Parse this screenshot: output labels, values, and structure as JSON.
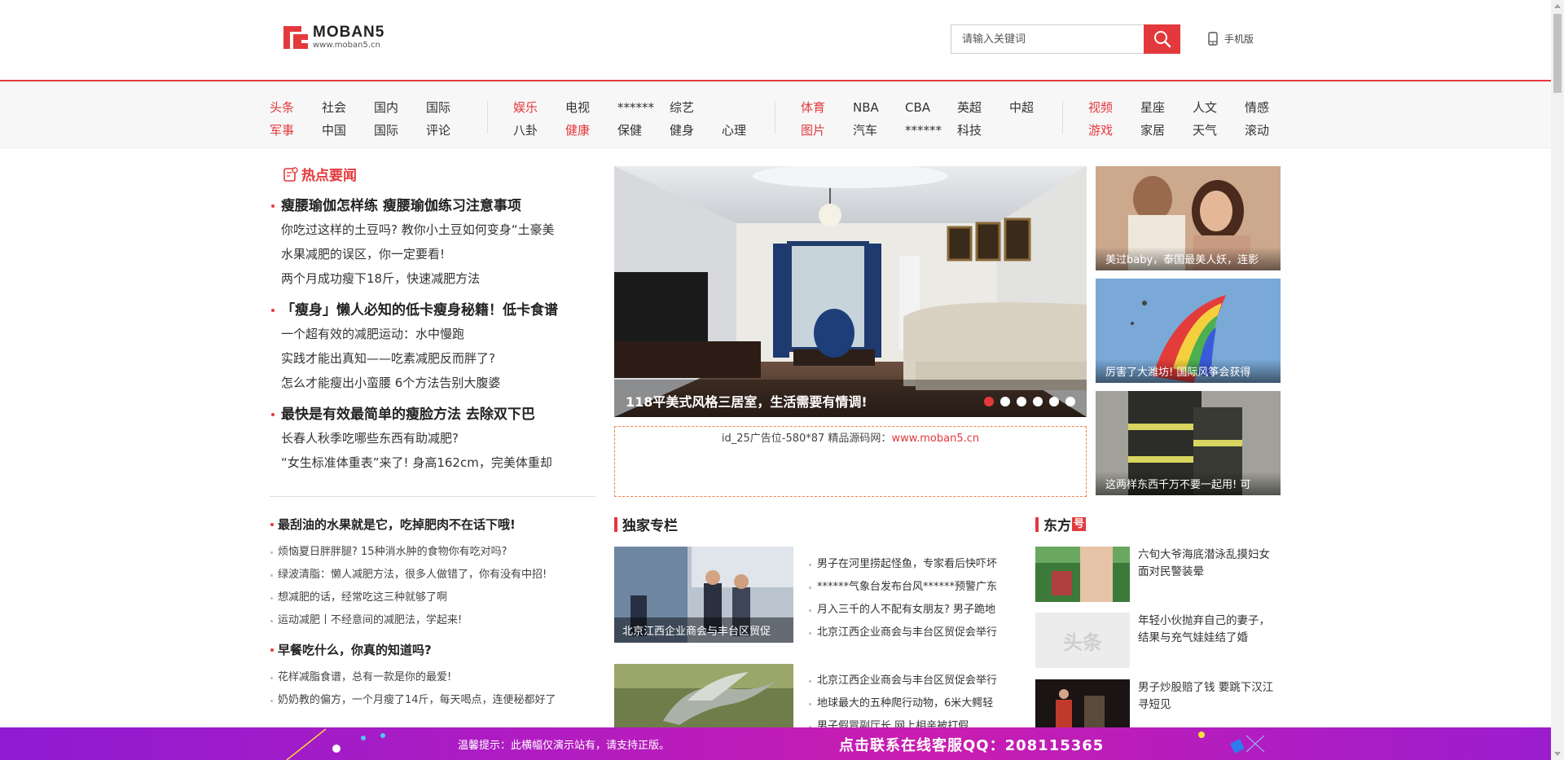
{
  "header": {
    "logo_text": "MOBAN5",
    "logo_url": "www.moban5.cn",
    "search_placeholder": "请输入关键词",
    "mobile_label": "手机版"
  },
  "nav": {
    "group1": [
      {
        "label": "头条",
        "hot": true
      },
      {
        "label": "社会"
      },
      {
        "label": "国内"
      },
      {
        "label": "国际"
      },
      {
        "label": "军事",
        "hot": true
      },
      {
        "label": "中国"
      },
      {
        "label": "国际"
      },
      {
        "label": "评论"
      }
    ],
    "group2": [
      {
        "label": "娱乐",
        "hot": true
      },
      {
        "label": "电视"
      },
      {
        "label": "******"
      },
      {
        "label": "综艺"
      },
      {
        "label": ""
      },
      {
        "label": "八卦"
      },
      {
        "label": "健康",
        "hot": true
      },
      {
        "label": "保健"
      },
      {
        "label": "健身"
      },
      {
        "label": "心理"
      }
    ],
    "group3": [
      {
        "label": "体育",
        "hot": true
      },
      {
        "label": "NBA"
      },
      {
        "label": "CBA"
      },
      {
        "label": "英超"
      },
      {
        "label": "中超"
      },
      {
        "label": "图片",
        "hot": true
      },
      {
        "label": "汽车"
      },
      {
        "label": "******"
      },
      {
        "label": "科技"
      },
      {
        "label": ""
      }
    ],
    "group4": [
      {
        "label": "视频",
        "hot": true
      },
      {
        "label": "星座"
      },
      {
        "label": "人文"
      },
      {
        "label": "情感"
      },
      {
        "label": "游戏",
        "hot": true
      },
      {
        "label": "家居"
      },
      {
        "label": "天气"
      },
      {
        "label": "滚动"
      }
    ]
  },
  "hot_news": {
    "title": "热点要闻",
    "blocks": [
      {
        "headline": "瘦腰瑜伽怎样练 瘦腰瑜伽练习注意事项",
        "subs": [
          "你吃过这样的土豆吗? 教你小土豆如何变身“土豪美",
          "水果减肥的误区，你一定要看!",
          "两个月成功瘦下18斤，快速减肥方法"
        ]
      },
      {
        "headline": "「瘦身」懒人必知的低卡瘦身秘籍！低卡食谱",
        "subs": [
          "一个超有效的减肥运动：水中慢跑",
          "实践才能出真知——吃素减肥反而胖了?",
          "怎么才能瘦出小蛮腰 6个方法告别大腹婆"
        ]
      },
      {
        "headline": "最快是有效最简单的瘦脸方法 去除双下巴",
        "subs": [
          "长春人秋季吃哪些东西有助减肥?",
          "“女生标准体重表”来了! 身高162cm，完美体重却"
        ]
      }
    ]
  },
  "left_lists": [
    {
      "headline": "最刮油的水果就是它，吃掉肥肉不在话下哦!",
      "items": [
        "烦恼夏日胖胖腿? 15种消水肿的食物你有吃对吗?",
        "绿波清脂：懒人减肥方法，很多人做错了，你有没有中招!",
        "想减肥的话，经常吃这三种就够了啊",
        "运动减肥丨不经意间的减肥法，学起来!"
      ]
    },
    {
      "headline": "早餐吃什么，你真的知道吗?",
      "items": [
        "花样减脂食谱，总有一款是你的最爱!",
        "奶奶教的偏方，一个月瘦了14斤，每天喝点，连便秘都好了"
      ]
    }
  ],
  "slider": {
    "caption": "118平美式风格三居室，生活需要有情调!",
    "dots": 6,
    "active_dot": 0
  },
  "ad": {
    "text": "id_25广告位-580*87 精品源码网：",
    "link": "www.moban5.cn"
  },
  "side_thumbs": [
    {
      "caption": "美过baby，泰国最美人妖，连影"
    },
    {
      "caption": "厉害了大潍坊! 国际风筝会获得"
    },
    {
      "caption": "这两样东西千万不要一起用! 可"
    }
  ],
  "exclusive": {
    "title": "独家专栏",
    "blocks": [
      {
        "caption": "北京江西企业商会与丰台区贸促",
        "items": [
          "男子在河里捞起怪鱼，专家看后快吓坏",
          "******气象台发布台风******预警广东",
          "月入三千的人不配有女朋友? 男子跪地",
          "北京江西企业商会与丰台区贸促会举行"
        ]
      },
      {
        "caption": "",
        "items": [
          "北京江西企业商会与丰台区贸促会举行",
          "地球最大的五种爬行动物，6米大鳄轻",
          "男子假冒副厅长 网上相亲被打假"
        ]
      }
    ]
  },
  "dongfang": {
    "title": "东方",
    "title_badge": "号",
    "items": [
      {
        "text": "六旬大爷海底潜泳乱摸妇女 面对民警装晕"
      },
      {
        "text": "年轻小伙抛弃自己的妻子，结果与充气娃娃结了婚",
        "placeholder": "头条"
      },
      {
        "text": "男子炒股赔了钱 要跳下汉江寻短见"
      }
    ]
  },
  "banner": {
    "tip": "温馨提示：此横幅仅演示站有，请支持正版。",
    "qq": "点击联系在线客服QQ：208115365"
  },
  "colors": {
    "accent": "#e4393c",
    "banner_start": "#8e1bd2",
    "banner_end": "#c91db0"
  }
}
